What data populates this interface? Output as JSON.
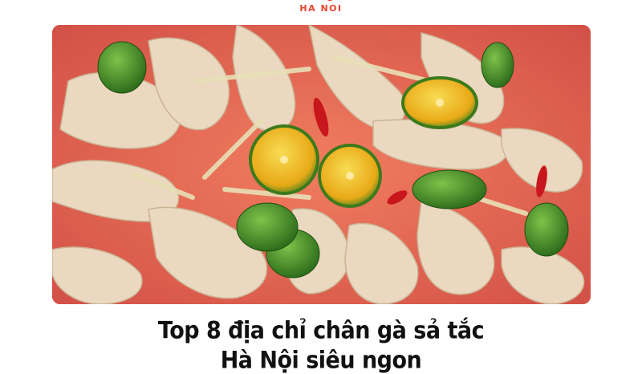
{
  "brand": {
    "name": "HA NOI"
  },
  "article": {
    "title_line1": "Top 8 địa chỉ chân gà sả tắc",
    "title_line2": "Hà Nội siêu ngon"
  },
  "photo": {
    "subject": "chicken-feet-lemongrass-kumquat",
    "colors": {
      "bowl": "#d9281f",
      "feet": "#e9d7c0",
      "kumquat": "#f2c12e",
      "lime_skin": "#3f8f2a",
      "lemongrass": "#e6dcb0",
      "chili": "#c8161d"
    }
  }
}
